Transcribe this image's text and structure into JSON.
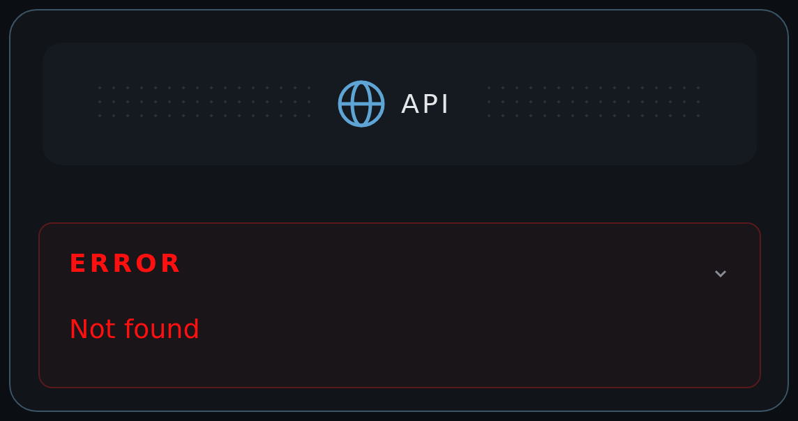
{
  "header": {
    "title": "API"
  },
  "error": {
    "label": "ERROR",
    "message": "Not found",
    "expanded": true
  }
}
